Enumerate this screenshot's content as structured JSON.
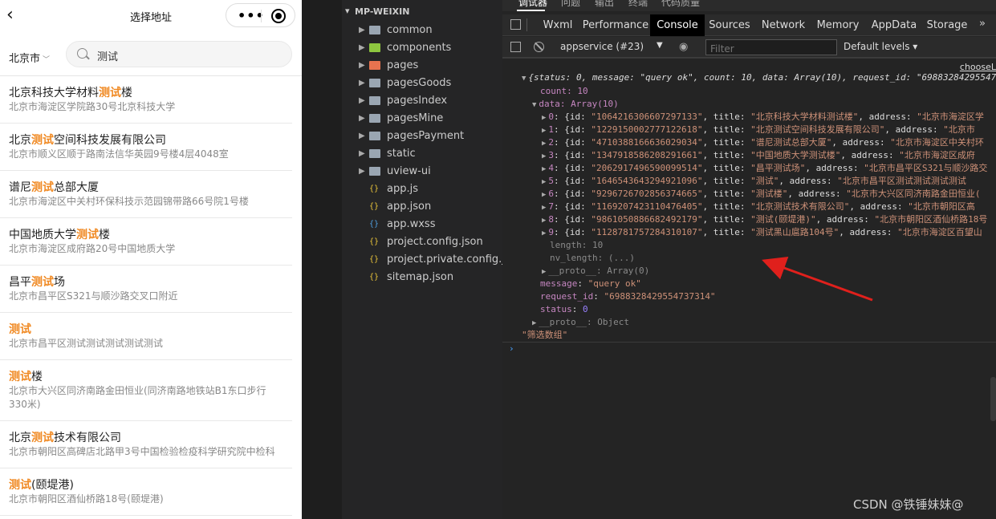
{
  "phone": {
    "title": "选择地址",
    "city": "北京市",
    "search_value": "测试",
    "results": [
      {
        "pre": "北京科技大学材料",
        "hl": "测试",
        "post": "楼",
        "addr": "北京市海淀区学院路30号北京科技大学"
      },
      {
        "pre": "北京",
        "hl": "测试",
        "post": "空间科技发展有限公司",
        "addr": "北京市顺义区顺于路南法信华英园9号楼4层4048室"
      },
      {
        "pre": "谱尼",
        "hl": "测试",
        "post": "总部大厦",
        "addr": "北京市海淀区中关村环保科技示范园锦带路66号院1号楼"
      },
      {
        "pre": "中国地质大学",
        "hl": "测试",
        "post": "楼",
        "addr": "北京市海淀区成府路20号中国地质大学"
      },
      {
        "pre": "昌平",
        "hl": "测试",
        "post": "场",
        "addr": "北京市昌平区S321与顺沙路交叉口附近"
      },
      {
        "pre": "",
        "hl": "测试",
        "post": "",
        "addr": "北京市昌平区测试测试测试测试测试"
      },
      {
        "pre": "",
        "hl": "测试",
        "post": "楼",
        "addr": "北京市大兴区同济南路金田恒业(同济南路地铁站B1东口步行330米)"
      },
      {
        "pre": "北京",
        "hl": "测试",
        "post": "技术有限公司",
        "addr": "北京市朝阳区高碑店北路甲3号中国检验检疫科学研究院中检科"
      },
      {
        "pre": "",
        "hl": "测试",
        "post": "(颐堤港)",
        "addr": "北京市朝阳区酒仙桥路18号(颐堤港)"
      }
    ]
  },
  "explorer": {
    "root": "MP-WEIXIN",
    "items": [
      {
        "name": "common",
        "kind": "folder",
        "color": "#9aa6b2"
      },
      {
        "name": "components",
        "kind": "folder",
        "color": "#8dc63f"
      },
      {
        "name": "pages",
        "kind": "folder",
        "color": "#e8734f"
      },
      {
        "name": "pagesGoods",
        "kind": "folder",
        "color": "#9aa6b2"
      },
      {
        "name": "pagesIndex",
        "kind": "folder",
        "color": "#9aa6b2"
      },
      {
        "name": "pagesMine",
        "kind": "folder",
        "color": "#9aa6b2"
      },
      {
        "name": "pagesPayment",
        "kind": "folder",
        "color": "#9aa6b2"
      },
      {
        "name": "static",
        "kind": "folder",
        "color": "#9aa6b2"
      },
      {
        "name": "uview-ui",
        "kind": "folder",
        "color": "#9aa6b2"
      },
      {
        "name": "app.js",
        "kind": "file",
        "color": "#e8c33a"
      },
      {
        "name": "app.json",
        "kind": "file",
        "color": "#e8c33a"
      },
      {
        "name": "app.wxss",
        "kind": "file",
        "color": "#4f9fe0"
      },
      {
        "name": "project.config.json",
        "kind": "file",
        "color": "#e8c33a"
      },
      {
        "name": "project.private.config.js...",
        "kind": "file",
        "color": "#e8c33a"
      },
      {
        "name": "sitemap.json",
        "kind": "file",
        "color": "#e8c33a"
      }
    ]
  },
  "devtools": {
    "top_tabs": [
      "调试器",
      "问题",
      "输出",
      "终端",
      "代码质量"
    ],
    "panel_tabs": [
      "Wxml",
      "Performance",
      "Console",
      "Sources",
      "Network",
      "Memory",
      "AppData",
      "Storage"
    ],
    "active_panel": "Console",
    "context": "appservice (#23)",
    "filter_placeholder": "Filter",
    "levels": "Default levels",
    "source_link": "chooseL",
    "console": {
      "head": "{status: 0, message: \"query ok\", count: 10, data: Array(10), request_id: \"69883284295547",
      "count_line": "count: 10",
      "data_line": "data: Array(10)",
      "entries": [
        {
          "i": "0",
          "id": "1064216306607297133",
          "title": "北京科技大学材料测试楼",
          "addr": "北京市海淀区学"
        },
        {
          "i": "1",
          "id": "1229150002777122618",
          "title": "北京测试空间科技发展有限公司",
          "addr": "北京市"
        },
        {
          "i": "2",
          "id": "4710388166636029034",
          "title": "谱尼测试总部大厦",
          "addr": "北京市海淀区中关村环"
        },
        {
          "i": "3",
          "id": "1347918586208291661",
          "title": "中国地质大学测试楼",
          "addr": "北京市海淀区成府"
        },
        {
          "i": "4",
          "id": "2062917496590099514",
          "title": "昌平测试场",
          "addr": "北京市昌平区S321与顺沙路交"
        },
        {
          "i": "5",
          "id": "1646543643294921096",
          "title": "测试",
          "addr": "北京市昌平区测试测试测试测试"
        },
        {
          "i": "6",
          "id": "9296726702856374665",
          "title": "测试楼",
          "addr": "北京市大兴区同济南路金田恒业("
        },
        {
          "i": "7",
          "id": "1169207423110476405",
          "title": "北京测试技术有限公司",
          "addr": "北京市朝阳区高"
        },
        {
          "i": "8",
          "id": "9861050886682492179",
          "title": "测试(颐堤港)",
          "addr": "北京市朝阳区酒仙桥路18号"
        },
        {
          "i": "9",
          "id": "1128781757284310107",
          "title": "测试黑山扈路104号",
          "addr": "北京市海淀区百望山"
        }
      ],
      "length_line": "length: 10",
      "nv_line": "nv_length: (...)",
      "proto_arr": "__proto__: Array(0)",
      "message_val": "\"query ok\"",
      "request_val": "\"6988328429554737314\"",
      "status_val": "0",
      "proto_obj": "__proto__: Object",
      "filter_msg": "\"筛选数组\""
    },
    "accent_arrow": "#e0201c"
  },
  "watermark": "CSDN @铁锤妹妹@"
}
